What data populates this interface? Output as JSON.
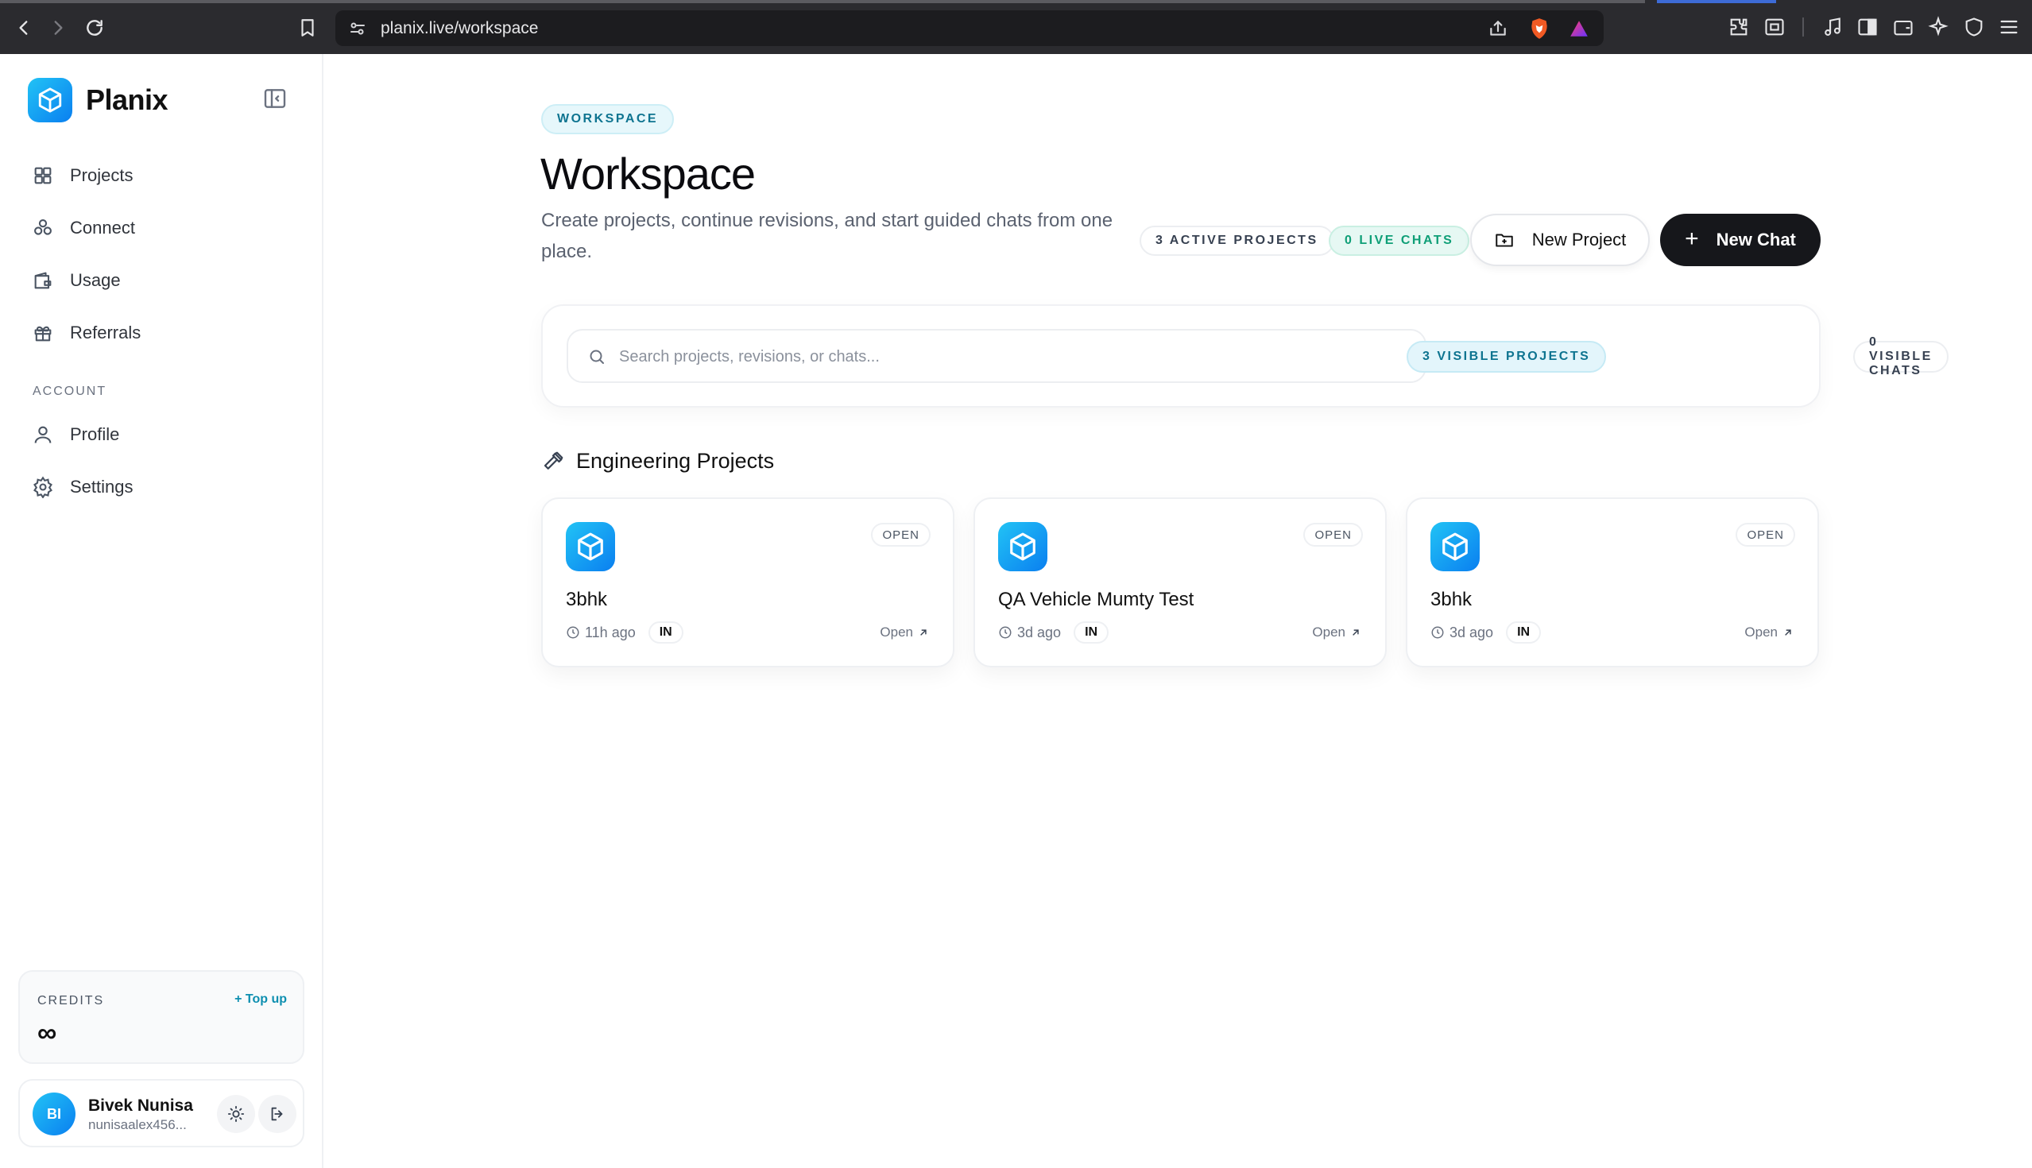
{
  "browser": {
    "url": "planix.live/workspace"
  },
  "sidebar": {
    "brand": "Planix",
    "items": [
      {
        "label": "Projects",
        "icon": "grid-icon"
      },
      {
        "label": "Connect",
        "icon": "nodes-icon"
      },
      {
        "label": "Usage",
        "icon": "wallet-icon"
      },
      {
        "label": "Referrals",
        "icon": "gift-icon"
      }
    ],
    "account_label": "ACCOUNT",
    "account_items": [
      {
        "label": "Profile",
        "icon": "user-icon"
      },
      {
        "label": "Settings",
        "icon": "gear-icon"
      }
    ],
    "credits": {
      "label": "CREDITS",
      "topup": "Top up",
      "value": "∞"
    },
    "user": {
      "initials": "BI",
      "name": "Bivek Nunisa",
      "email": "nunisaalex456..."
    }
  },
  "main": {
    "tag": "WORKSPACE",
    "title": "Workspace",
    "subtitle": "Create projects, continue revisions, and start guided chats from one place.",
    "active_projects": "3 ACTIVE PROJECTS",
    "live_chats": "0 LIVE CHATS",
    "new_project": "New Project",
    "new_chat": "New Chat",
    "search_placeholder": "Search projects, revisions, or chats...",
    "visible_projects": "3 VISIBLE PROJECTS",
    "visible_chats": "0 VISIBLE CHATS",
    "section_title": "Engineering Projects",
    "projects": [
      {
        "name": "3bhk",
        "time": "11h ago",
        "locale": "IN",
        "status": "OPEN",
        "open": "Open"
      },
      {
        "name": "QA Vehicle Mumty Test",
        "time": "3d ago",
        "locale": "IN",
        "status": "OPEN",
        "open": "Open"
      },
      {
        "name": "3bhk",
        "time": "3d ago",
        "locale": "IN",
        "status": "OPEN",
        "open": "Open"
      }
    ]
  },
  "colors": {
    "accent": "#0a7ff0",
    "accent_light": "#22c3f5",
    "dark_button": "#16171b",
    "green": "#0f9f77"
  }
}
